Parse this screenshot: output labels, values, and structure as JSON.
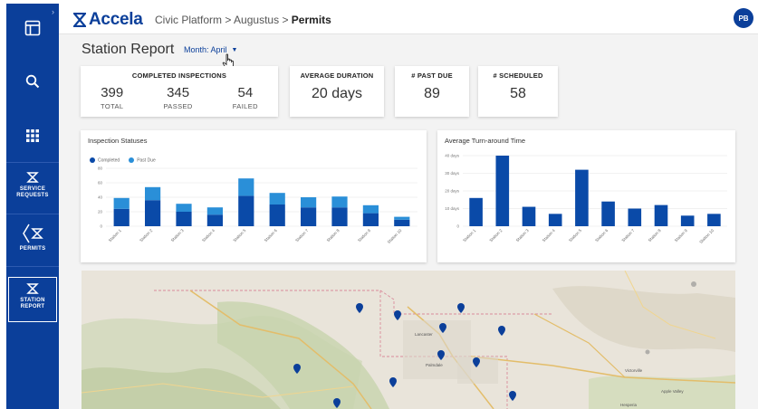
{
  "brand": {
    "name": "Accela"
  },
  "breadcrumb": {
    "parts": [
      "Civic Platform",
      "Augustus"
    ],
    "sep": ">",
    "current": "Permits"
  },
  "user": {
    "initials": "PB"
  },
  "sidebar": {
    "items": [
      {
        "label": "SERVICE\nREQUESTS",
        "icon": "service-requests-icon"
      },
      {
        "label": "PERMITS",
        "icon": "permits-icon"
      },
      {
        "label": "STATION\nREPORT",
        "icon": "station-report-icon"
      }
    ]
  },
  "page": {
    "title": "Station Report",
    "month_label": "Month: April"
  },
  "stats": {
    "completed": {
      "title": "COMPLETED INSPECTIONS",
      "items": [
        {
          "value": "399",
          "label": "TOTAL"
        },
        {
          "value": "345",
          "label": "PASSED"
        },
        {
          "value": "54",
          "label": "FAILED"
        }
      ]
    },
    "duration": {
      "title": "AVERAGE DURATION",
      "value": "20 days"
    },
    "past_due": {
      "title": "# PAST DUE",
      "value": "89"
    },
    "scheduled": {
      "title": "# SCHEDULED",
      "value": "58"
    }
  },
  "colors": {
    "primary": "#0b3f9a",
    "dark_bar": "#0a4aa8",
    "light_bar": "#2a8fd8"
  },
  "chart_data": [
    {
      "type": "bar",
      "title": "Inspection Statuses",
      "stacked": true,
      "categories": [
        "Station 1",
        "Station 2",
        "Station 3",
        "Station 4",
        "Station 5",
        "Station 6",
        "Station 7",
        "Station 8",
        "Station 9",
        "Station 10"
      ],
      "series": [
        {
          "name": "Completed",
          "values": [
            24,
            36,
            20,
            16,
            42,
            30,
            26,
            26,
            18,
            9
          ]
        },
        {
          "name": "Past Due",
          "values": [
            15,
            18,
            11,
            10,
            24,
            16,
            14,
            15,
            11,
            4
          ]
        }
      ],
      "yticks": [
        0,
        20,
        40,
        60,
        80
      ],
      "ylim": [
        0,
        80
      ],
      "legend": "top-left",
      "grid": true
    },
    {
      "type": "bar",
      "title": "Average Turn-around Time",
      "categories": [
        "Station 1",
        "Station 2",
        "Station 3",
        "Station 4",
        "Station 5",
        "Station 6",
        "Station 7",
        "Station 8",
        "Station 9",
        "Station 10"
      ],
      "values": [
        16,
        40,
        11,
        7,
        32,
        14,
        10,
        12,
        6,
        7
      ],
      "yticks": [
        "0",
        "10 days",
        "20 days",
        "30 days",
        "40 days"
      ],
      "ylim": [
        0,
        40
      ],
      "grid": true
    }
  ],
  "map": {
    "place_labels": [
      "Lancaster",
      "Palmdale",
      "Victorville",
      "Apple Valley",
      "Hesperia"
    ]
  }
}
